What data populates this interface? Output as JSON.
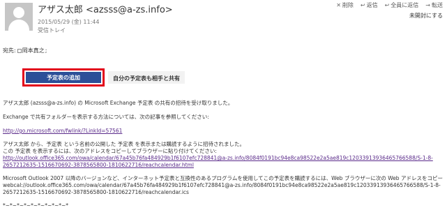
{
  "header": {
    "sender": "アザス太郎 <azsss@a-zs.info>",
    "date": "2015/05/29 (金) 11:44",
    "folder": "受信トレイ",
    "status": "未開封にする",
    "toolbar": [
      {
        "icon": "delete-icon",
        "glyph": "✕",
        "label": "削除"
      },
      {
        "icon": "reply-icon",
        "glyph": "↩",
        "label": "返信"
      },
      {
        "icon": "reply-all-icon",
        "glyph": "↩",
        "label": "全員に返信"
      },
      {
        "icon": "forward-icon",
        "glyph": "→",
        "label": "転送"
      }
    ]
  },
  "recipients": {
    "label": "宛先:",
    "name": "岡本真之"
  },
  "buttons": {
    "add": "予定表の追加",
    "share": "自分の予定表も相手と共有"
  },
  "body": {
    "line1": "アザス太郎 (azsss@a-zs.info) の Microsoft Exchange 予定表 の共有の招待を受け取りました。",
    "line2": "Exchange で共有フォルダーを表示する方法については、次の記事を参照してください:",
    "link1": "http://go.microsoft.com/fwlink/?LinkId=57561",
    "line3": "アザス太郎 から、予定表 という名前の公開した 予定表 を表示または購読するように招待されました。",
    "line4": "この 予定表 を表示するには、次のアドレスをコピーしてブラウザーに貼り付けてください:",
    "link2a": "http://outlook.office365.com/owa/calendar/67a45b76fa484929b1f6107efc728841@a-zs.info/8084f0191bc94e8ca98522e2a5ae819c12033913936465766588/S-1-8-",
    "link2b": "2657212635-1516670692-3878565800-1810622716/reachcalendar.html",
    "line5": "Microsoft Outlook 2007 以降のバージョンなど、インターネット予定表と互換性のあるプログラムを使用してこの予定表を購読するには、Web ブラウザーに次の Web アドレスをコピーして貼り付けてください:",
    "line6a": "webcal://outlook.office365.com/owa/calendar/67a45b76fa484929b1f6107efc728841@a-zs.info/8084f0191bc94e8ca98522e2a5ae819c12033913936465766588/S-1-8-",
    "line6b": "2657212635-1516670692-3878565800-1810622716/reachcalendar.ics",
    "separator": "*~*~*~*~*~*~*~*~*~*"
  }
}
